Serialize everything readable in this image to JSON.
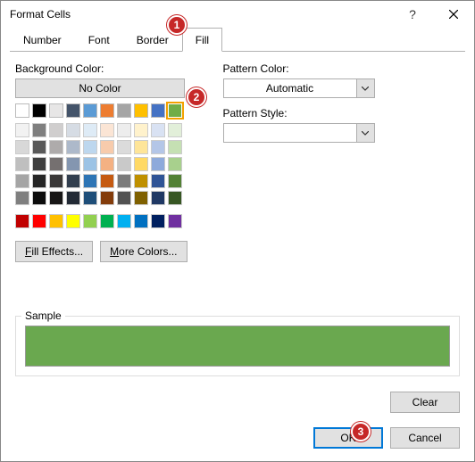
{
  "dialog": {
    "title": "Format Cells"
  },
  "tabs": {
    "number": "Number",
    "font": "Font",
    "border": "Border",
    "fill": "Fill"
  },
  "fill": {
    "bgLabel": "Background Color:",
    "noColor": "No Color",
    "fillEffects": "Fill Effects...",
    "moreColors": "More Colors...",
    "patternColorLabel": "Pattern Color:",
    "patternColorValue": "Automatic",
    "patternStyleLabel": "Pattern Style:",
    "patternStyleValue": ""
  },
  "sample": {
    "label": "Sample",
    "color": "#6aa84f"
  },
  "buttons": {
    "clear": "Clear",
    "ok": "OK",
    "cancel": "Cancel"
  },
  "callouts": {
    "a": "1",
    "b": "2",
    "c": "3"
  },
  "themeRow": [
    "#ffffff",
    "#000000",
    "#e7e6e6",
    "#44546a",
    "#5b9bd5",
    "#ed7d31",
    "#a5a5a5",
    "#ffc000",
    "#4472c4",
    "#70ad47"
  ],
  "themeGrid": [
    [
      "#f2f2f2",
      "#7f7f7f",
      "#d0cece",
      "#d6dce4",
      "#deebf6",
      "#fbe5d5",
      "#ededed",
      "#fff2cc",
      "#d9e2f3",
      "#e2efd9"
    ],
    [
      "#d8d8d8",
      "#595959",
      "#aeabab",
      "#adb9ca",
      "#bdd7ee",
      "#f7cbac",
      "#dbdbdb",
      "#fee599",
      "#b4c6e7",
      "#c5e0b3"
    ],
    [
      "#bfbfbf",
      "#3f3f3f",
      "#757070",
      "#8496b0",
      "#9cc3e5",
      "#f4b183",
      "#c9c9c9",
      "#ffd965",
      "#8eaadb",
      "#a8d08d"
    ],
    [
      "#a5a5a5",
      "#262626",
      "#3a3838",
      "#323f4f",
      "#2e75b5",
      "#c55a11",
      "#7b7b7b",
      "#bf9000",
      "#2f5496",
      "#538135"
    ],
    [
      "#7f7f7f",
      "#0c0c0c",
      "#171616",
      "#222a35",
      "#1e4e79",
      "#833c0b",
      "#525252",
      "#7f6000",
      "#1f3864",
      "#375623"
    ]
  ],
  "standard": [
    "#c00000",
    "#ff0000",
    "#ffc000",
    "#ffff00",
    "#92d050",
    "#00b050",
    "#00b0f0",
    "#0070c0",
    "#002060",
    "#7030a0"
  ]
}
